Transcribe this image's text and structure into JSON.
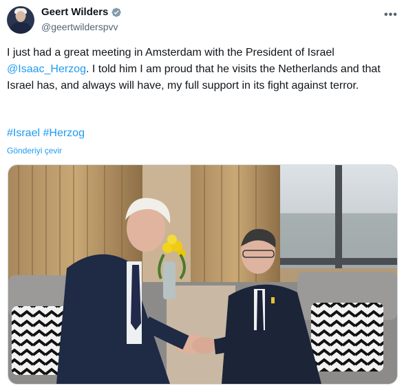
{
  "author": {
    "name": "Geert Wilders",
    "handle": "@geertwilderspvv",
    "verified_icon": "verified-badge-icon"
  },
  "more_label": "•••",
  "tweet": {
    "text_part1": "I just had a great meeting in Amsterdam with the President of Israel ",
    "mention": "@Isaac_Herzog",
    "text_part2": ". I told him I am proud that he visits the Netherlands and that Israel has, and always will have, my full support in its fight against terror.",
    "hashtag1": "#Israel",
    "hashtag2": "#Herzog",
    "translate_label": "Gönderiyi çevir"
  },
  "colors": {
    "link": "#1d9bf0",
    "text": "#0f1419",
    "secondary": "#536471"
  }
}
